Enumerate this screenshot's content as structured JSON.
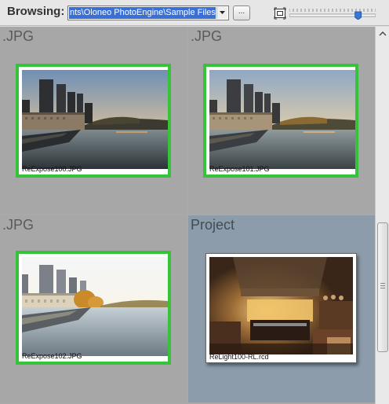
{
  "toolbar": {
    "browsing_label": "Browsing:",
    "path_value": "nts\\Oloneo PhotoEngine\\Sample Files\\",
    "browse_button_label": "...",
    "zoom_level": 0.82
  },
  "cells": [
    {
      "title": ".JPG",
      "caption": "ReExpose100.JPG",
      "selected": true,
      "image": "river-sunset"
    },
    {
      "title": ".JPG",
      "caption": "ReExpose101.JPG",
      "selected": true,
      "image": "river-sunset"
    },
    {
      "title": ".JPG",
      "caption": "ReExpose102.JPG",
      "selected": true,
      "image": "river-day"
    },
    {
      "title": "Project",
      "caption": "ReLight100-RL.rcd",
      "selected": false,
      "image": "kitchen-interior"
    }
  ],
  "colors": {
    "selection_border": "#35c33a",
    "highlight": "#3a6fd6",
    "project_background": "#8c9cab"
  },
  "icons": {
    "combo_arrow": "chevron-down-icon",
    "zoom": "fit-zoom-icon",
    "scroll_up": "chevron-up-icon"
  }
}
